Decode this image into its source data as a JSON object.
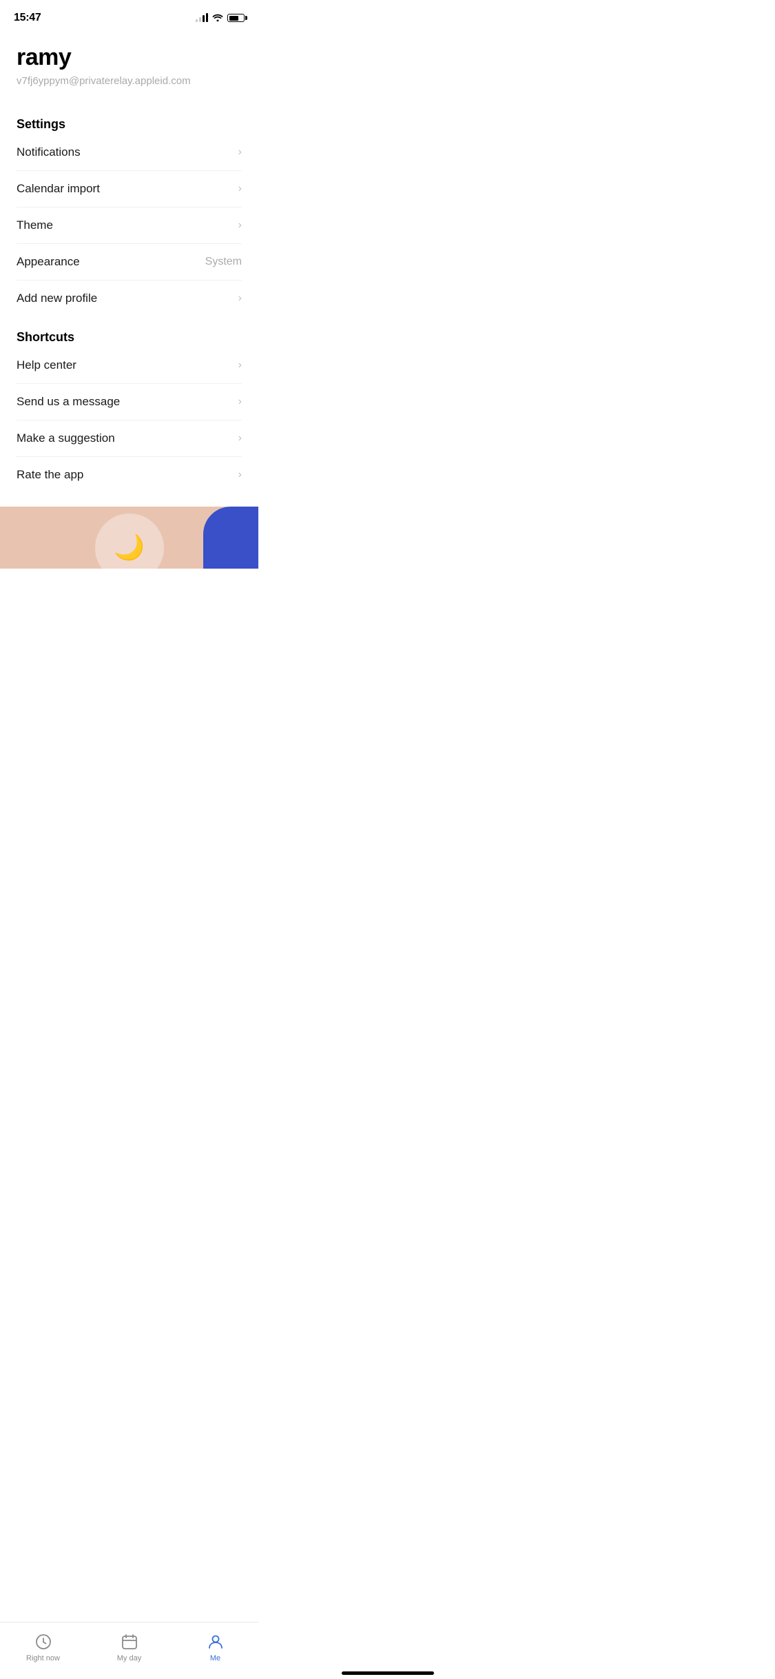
{
  "statusBar": {
    "time": "15:47"
  },
  "profile": {
    "name": "ramy",
    "email": "v7fj6yppym@privaterelay.appleid.com"
  },
  "settings": {
    "sectionTitle": "Settings",
    "items": [
      {
        "label": "Notifications",
        "value": "",
        "showChevron": true
      },
      {
        "label": "Calendar import",
        "value": "",
        "showChevron": true
      },
      {
        "label": "Theme",
        "value": "",
        "showChevron": true
      },
      {
        "label": "Appearance",
        "value": "System",
        "showChevron": false
      },
      {
        "label": "Add new profile",
        "value": "",
        "showChevron": true
      }
    ]
  },
  "shortcuts": {
    "sectionTitle": "Shortcuts",
    "items": [
      {
        "label": "Help center",
        "value": "",
        "showChevron": true
      },
      {
        "label": "Send us a message",
        "value": "",
        "showChevron": true
      },
      {
        "label": "Make a suggestion",
        "value": "",
        "showChevron": true
      },
      {
        "label": "Rate the app",
        "value": "",
        "showChevron": true
      }
    ]
  },
  "tabBar": {
    "items": [
      {
        "id": "right-now",
        "label": "Right now",
        "active": false
      },
      {
        "id": "my-day",
        "label": "My day",
        "active": false
      },
      {
        "id": "me",
        "label": "Me",
        "active": true
      }
    ]
  }
}
